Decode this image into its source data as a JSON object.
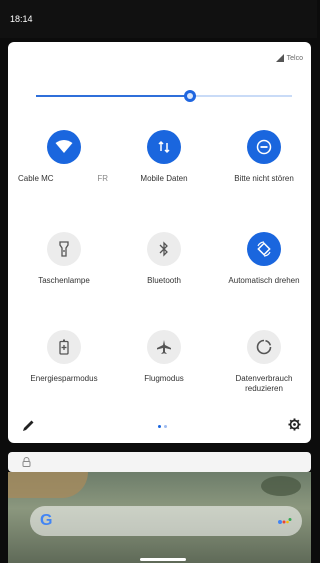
{
  "status_bar": {
    "time": "18:14"
  },
  "quick_settings": {
    "carrier": "Telco",
    "brightness_level": 0.6,
    "tiles": [
      {
        "id": "wifi",
        "label": "Cable MC",
        "sublabel": "FR",
        "on": true,
        "icon": "wifi-icon"
      },
      {
        "id": "mobile-data",
        "label": "Mobile Daten",
        "on": true,
        "icon": "mobile-data-icon"
      },
      {
        "id": "dnd",
        "label": "Bitte nicht stören",
        "on": true,
        "icon": "do-not-disturb-icon"
      },
      {
        "id": "flashlight",
        "label": "Taschenlampe",
        "on": false,
        "icon": "flashlight-icon"
      },
      {
        "id": "bluetooth",
        "label": "Bluetooth",
        "on": false,
        "icon": "bluetooth-icon"
      },
      {
        "id": "auto-rotate",
        "label": "Automatisch drehen",
        "on": true,
        "icon": "auto-rotate-icon"
      },
      {
        "id": "battery-saver",
        "label": "Energiesparmodus",
        "on": false,
        "icon": "battery-saver-icon"
      },
      {
        "id": "airplane",
        "label": "Flugmodus",
        "on": false,
        "icon": "airplane-icon"
      },
      {
        "id": "data-saver",
        "label": "Datenverbrauch",
        "label_line2": "reduzieren",
        "on": false,
        "icon": "data-saver-icon"
      }
    ],
    "page_indicator": {
      "pages": 2,
      "current": 1
    }
  },
  "colors": {
    "accent": "#1a66de",
    "tile_off": "#ececec"
  }
}
